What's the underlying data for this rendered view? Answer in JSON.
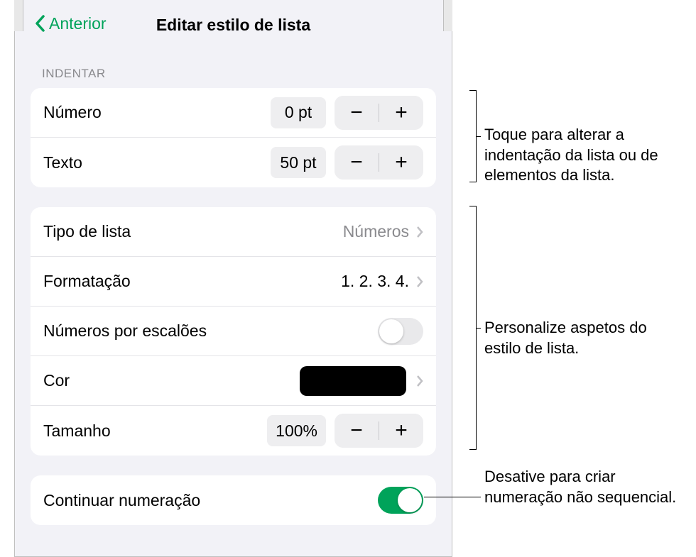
{
  "header": {
    "back_label": "Anterior",
    "title": "Editar estilo de lista"
  },
  "indent": {
    "section_title": "Indentar",
    "number_label": "Número",
    "number_value": "0 pt",
    "text_label": "Texto",
    "text_value": "50 pt"
  },
  "style": {
    "list_type_label": "Tipo de lista",
    "list_type_value": "Números",
    "format_label": "Formatação",
    "format_value": "1. 2. 3. 4.",
    "tiered_label": "Números por escalões",
    "color_label": "Cor",
    "size_label": "Tamanho",
    "size_value": "100%"
  },
  "continue": {
    "label": "Continuar numeração"
  },
  "callouts": {
    "indent": "Toque para alterar a indentação da lista ou de elementos da lista.",
    "style": "Personalize aspetos do estilo de lista.",
    "continue": "Desative para criar numeração não sequencial."
  },
  "glyphs": {
    "minus": "−",
    "plus": "+"
  }
}
